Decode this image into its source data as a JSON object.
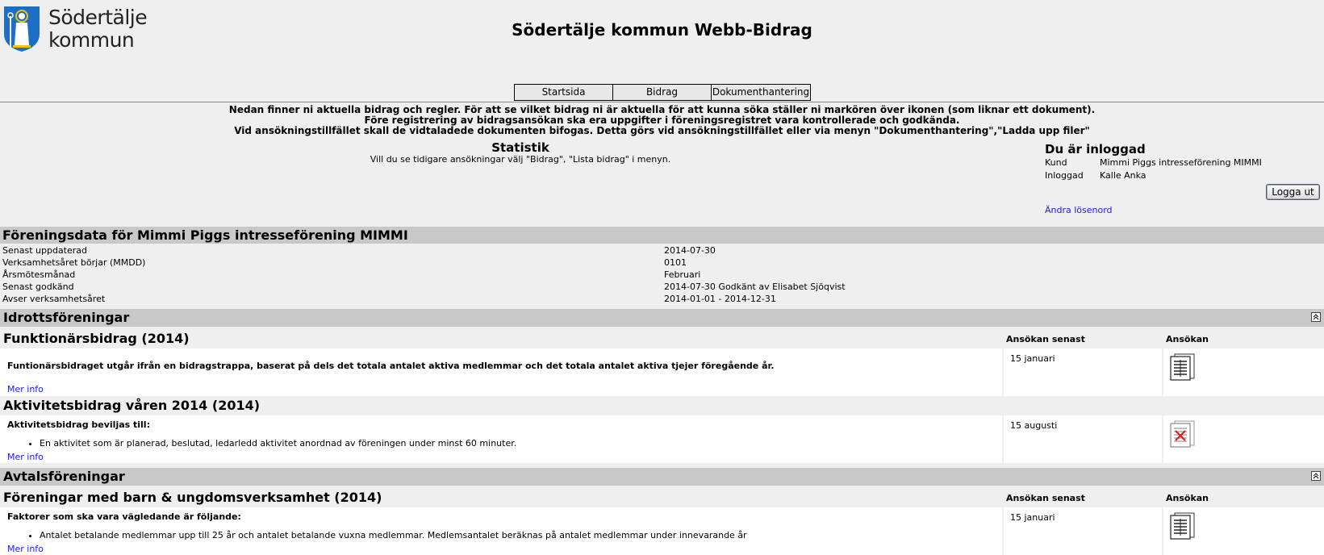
{
  "logo": {
    "line1": "Södertälje",
    "line2": "kommun"
  },
  "site_title": "Södertälje kommun Webb-Bidrag",
  "nav": {
    "tabs": [
      "Startsida",
      "Bidrag",
      "Dokumenthantering"
    ]
  },
  "notice": [
    "Nedan finner ni aktuella bidrag och regler. För att se vilket bidrag ni är aktuella för att kunna söka ställer ni markören över ikonen (som liknar ett dokument).",
    "Före registrering av bidragsansökan ska era uppgifter i föreningsregistret vara kontrollerade och godkända.",
    "Vid ansökningstillfället skall de vidtaladede dokumenten bifogas. Detta görs vid ansökningstillfället eller via menyn \"Dokumenthantering\",\"Ladda upp filer\""
  ],
  "stats": {
    "heading": "Statistik",
    "text": "Vill du se tidigare ansökningar välj \"Bidrag\", \"Lista bidrag\" i menyn."
  },
  "login": {
    "heading": "Du är inloggad",
    "customer_label": "Kund",
    "customer_value": "Mimmi Piggs intresseförening MIMMI",
    "user_label": "Inloggad",
    "user_value": "Kalle Anka",
    "logout": "Logga ut",
    "change_password": "Ändra lösenord"
  },
  "org": {
    "title": "Föreningsdata för Mimmi Piggs intresseförening MIMMI",
    "rows": [
      {
        "key": "Senast uppdaterad",
        "value": "2014-07-30"
      },
      {
        "key": "Verksamhetsåret börjar (MMDD)",
        "value": "0101"
      },
      {
        "key": "Årsmötesmånad",
        "value": "Februari"
      },
      {
        "key": "Senast godkänd",
        "value": "2014-07-30 Godkänt av Elisabet Sjöqvist"
      },
      {
        "key": "Avser verksamhetsåret",
        "value": "2014-01-01 - 2014-12-31"
      }
    ]
  },
  "sections": [
    {
      "title": "Idrottsföreningar",
      "col_deadline": "Ansökan senast",
      "col_apply": "Ansökan",
      "grants": [
        {
          "title": "Funktionärsbidrag (2014)",
          "desc": "Funtionärsbidraget utgår ifrån en bidragstrappa, baserat på dels det totala antalet aktiva medlemmar och det totala antalet aktiva tjejer föregående år.",
          "deadline": "15 januari",
          "more": "Mer info"
        },
        {
          "title": "Aktivitetsbidrag våren 2014 (2014)",
          "desc": "Aktivitetsbidrag beviljas till:",
          "bullets": [
            "En aktivitet som är planerad, beslutad, ledarledd aktivitet anordnad av föreningen under minst 60 minuter."
          ],
          "deadline": "15 augusti",
          "more": "Mer info"
        }
      ]
    },
    {
      "title": "Avtalsföreningar",
      "col_deadline": "Ansökan senast",
      "col_apply": "Ansökan",
      "grants": [
        {
          "title": "Föreningar med barn & ungdomsverksamhet (2014)",
          "desc": "Faktorer som ska vara vägledande är följande:",
          "bullets": [
            "Antalet betalande medlemmar upp till 25 år och antalet betalande vuxna medlemmar. Medlemsantalet beräknas på antalet medlemmar under innevarande år"
          ],
          "deadline": "15 januari",
          "more": "Mer info"
        }
      ]
    }
  ],
  "icons": {
    "collapse": "collapse-up-icon",
    "apply_doc": "document-icon",
    "apply_doc_disabled": "document-disabled-icon"
  },
  "colors": {
    "link": "#1a1aff",
    "bar": "#c8c8c8",
    "background": "#efefef"
  }
}
